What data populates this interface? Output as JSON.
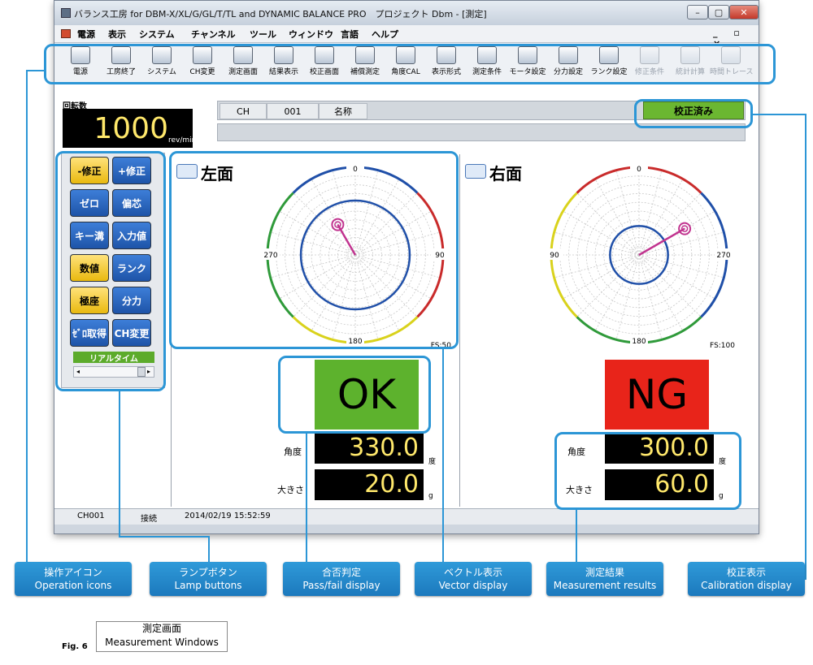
{
  "window": {
    "title": "バランス工房 for DBM-X/XL/G/GL/T/TL and DYNAMIC BALANCE PRO　プロジェクト Dbm - [測定]",
    "controls": {
      "minimize": "–",
      "maximize": "▢",
      "close": "✕"
    }
  },
  "menu": {
    "items": [
      "電源",
      "表示",
      "システム",
      "チャンネル",
      "ツール",
      "ウィンドウ",
      "言語",
      "ヘルプ"
    ],
    "mdi_controls": "_ ▫ ×"
  },
  "toolbar": {
    "tools": [
      {
        "label": "電源",
        "icon": "monitor-icon",
        "enabled": true
      },
      {
        "label": "工房終了",
        "icon": "exit-icon",
        "enabled": true
      },
      {
        "label": "システム",
        "icon": "gears-icon",
        "enabled": true
      },
      {
        "label": "CH変更",
        "icon": "channel-icon",
        "enabled": true
      },
      {
        "label": "測定画面",
        "icon": "measure-screen-icon",
        "enabled": true
      },
      {
        "label": "結果表示",
        "icon": "table-icon",
        "enabled": true
      },
      {
        "label": "校正画面",
        "icon": "calibration-icon",
        "enabled": true
      },
      {
        "label": "補償測定",
        "icon": "compensation-icon",
        "enabled": true
      },
      {
        "label": "角度CAL",
        "icon": "angle-icon",
        "enabled": true
      },
      {
        "label": "表示形式",
        "icon": "display-format-icon",
        "enabled": true
      },
      {
        "label": "測定条件",
        "icon": "condition-icon",
        "enabled": true
      },
      {
        "label": "モータ設定",
        "icon": "motor-icon",
        "enabled": true
      },
      {
        "label": "分力設定",
        "icon": "split-icon",
        "enabled": true
      },
      {
        "label": "ランク設定",
        "icon": "rank-icon",
        "enabled": true
      },
      {
        "label": "修正条件",
        "icon": "correction-icon",
        "enabled": false
      },
      {
        "label": "統計計算",
        "icon": "statistics-icon",
        "enabled": false
      },
      {
        "label": "時間トレース",
        "icon": "trace-icon",
        "enabled": false
      }
    ]
  },
  "rpm": {
    "label": "回転数",
    "value": "1000",
    "unit": "rev/min"
  },
  "info": {
    "ch_label": "CH",
    "ch_value": "001",
    "name_label": "名称",
    "calibration": "校正済み"
  },
  "lamps": {
    "buttons": [
      {
        "label": "-修正",
        "color": "yellow"
      },
      {
        "label": "+修正",
        "color": "blue"
      },
      {
        "label": "ゼロ",
        "color": "blue"
      },
      {
        "label": "偏芯",
        "color": "blue"
      },
      {
        "label": "キー溝",
        "color": "blue"
      },
      {
        "label": "入力値",
        "color": "blue"
      },
      {
        "label": "数値",
        "color": "yellow"
      },
      {
        "label": "ランク",
        "color": "blue"
      },
      {
        "label": "極座",
        "color": "yellow"
      },
      {
        "label": "分力",
        "color": "blue"
      },
      {
        "label": "ｾﾞﾛ取得",
        "color": "blue"
      },
      {
        "label": "CH変更",
        "color": "blue"
      }
    ],
    "realtime": "リアルタイム"
  },
  "left": {
    "title": "左面",
    "fs": "FS:50",
    "ticks": {
      "top": "0",
      "right": "90",
      "bottom": "180",
      "left": "270"
    },
    "judge": "OK",
    "judge_color": "#5db22d",
    "angle_label": "角度",
    "angle_value": "330.0",
    "angle_unit": "度",
    "mag_label": "大きさ",
    "mag_value": "20.0",
    "mag_unit": "g"
  },
  "right": {
    "title": "右面",
    "fs": "FS:100",
    "ticks": {
      "top": "0",
      "right": "270",
      "bottom": "180",
      "left": "90"
    },
    "judge": "NG",
    "judge_color": "#e8241a",
    "angle_label": "角度",
    "angle_value": "300.0",
    "angle_unit": "度",
    "mag_label": "大きさ",
    "mag_value": "60.0",
    "mag_unit": "g"
  },
  "status": {
    "channel": "CH001",
    "connection": "接続",
    "datetime": "2014/02/19 15:52:59"
  },
  "callouts": [
    {
      "jp": "操作アイコン",
      "en": "Operation icons"
    },
    {
      "jp": "ランプボタン",
      "en": "Lamp buttons"
    },
    {
      "jp": "合否判定",
      "en": "Pass/fail display"
    },
    {
      "jp": "ベクトル表示",
      "en": "Vector display"
    },
    {
      "jp": "測定結果",
      "en": "Measurement results"
    },
    {
      "jp": "校正表示",
      "en": "Calibration display"
    }
  ],
  "figure": {
    "number": "Fig. 6",
    "title_jp": "測定画面",
    "title_en": "Measurement Windows"
  },
  "colors": {
    "accent": "#2c96d6",
    "display_digits": "#ffe86b",
    "ok": "#5db22d",
    "ng": "#e8241a",
    "calibrated": "#6bb731"
  }
}
